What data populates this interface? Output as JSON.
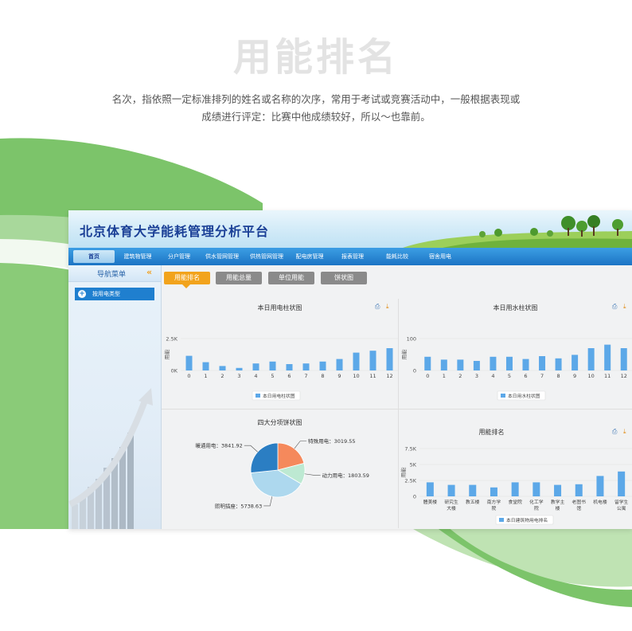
{
  "header": {
    "title": "用能排名",
    "desc_line1": "名次，指依照一定标准排列的姓名或名称的次序，常用于考试或竞赛活动中，一般根据表现或",
    "desc_line2": "成绩进行评定：比赛中他成绩较好，所以～也靠前。"
  },
  "app": {
    "banner_title": "北京体育大学能耗管理分析平台",
    "nav": [
      {
        "label": "首页",
        "active": true
      },
      {
        "label": "建筑物管理"
      },
      {
        "label": "分户管理"
      },
      {
        "label": "供水管网管理"
      },
      {
        "label": "供热管网管理"
      },
      {
        "label": "配电房管理"
      },
      {
        "label": "报表管理"
      },
      {
        "label": "能耗比较"
      },
      {
        "label": "宿舍用电"
      }
    ],
    "sidebar": {
      "title": "导航菜单",
      "collapse_icon": "double-chevron-left-icon",
      "items": [
        {
          "label": "按用电类型",
          "icon": "plus-circle-icon"
        }
      ]
    },
    "tabs": [
      {
        "label": "用能排名",
        "active": true
      },
      {
        "label": "用能总量"
      },
      {
        "label": "单位用能"
      },
      {
        "label": "饼状图"
      }
    ],
    "icons": {
      "print": "printer-icon",
      "download": "download-icon"
    }
  },
  "colors": {
    "nav_blue": "#1c74c4",
    "tab_active": "#f2a31c",
    "tab_inactive": "#8a8a8a",
    "bar": "#5ca8e8",
    "green_swoosh": "#7cc46a"
  },
  "chart_data": [
    {
      "type": "bar",
      "title": "本日用电柱状图",
      "ylabel": "用能",
      "y_ticks": [
        "0K",
        "2.5K"
      ],
      "ylim": [
        0,
        2500
      ],
      "categories": [
        "0",
        "1",
        "2",
        "3",
        "4",
        "5",
        "6",
        "7",
        "8",
        "9",
        "10",
        "11",
        "12"
      ],
      "series": [
        {
          "name": "本日用电柱状图",
          "values": [
            1150,
            650,
            350,
            200,
            550,
            700,
            500,
            550,
            700,
            900,
            1400,
            1550,
            1750
          ]
        }
      ]
    },
    {
      "type": "bar",
      "title": "本日用水柱状图",
      "ylabel": "用能",
      "y_ticks": [
        "0",
        "100"
      ],
      "ylim": [
        0,
        100
      ],
      "categories": [
        "0",
        "1",
        "2",
        "3",
        "4",
        "5",
        "6",
        "7",
        "8",
        "9",
        "10",
        "11",
        "12"
      ],
      "series": [
        {
          "name": "本日用水柱状图",
          "values": [
            43,
            34,
            34,
            30,
            43,
            43,
            36,
            45,
            38,
            49,
            70,
            81,
            70
          ]
        }
      ]
    },
    {
      "type": "pie",
      "title": "四大分项饼状图",
      "slices": [
        {
          "label": "特殊用电",
          "value": 3019.55,
          "color": "#f5895c"
        },
        {
          "label": "动力用电",
          "value": 1803.59,
          "color": "#bde9d2"
        },
        {
          "label": "照明插座",
          "value": 5738.63,
          "color": "#add8ee"
        },
        {
          "label": "暖通用电",
          "value": 3841.92,
          "color": "#2b7ec3"
        }
      ]
    },
    {
      "type": "bar",
      "title": "用能排名",
      "ylabel": "用能",
      "y_ticks": [
        "0",
        "2.5K",
        "5K",
        "7.5K"
      ],
      "ylim": [
        0,
        7500
      ],
      "categories": [
        "體美楼",
        "研究生大楼",
        "教五楼",
        "南方学院",
        "食堂院",
        "化工学院",
        "教学主楼",
        "老图书馆",
        "机电楼",
        "留学生公寓"
      ],
      "series": [
        {
          "name": "本日建筑物用电排名",
          "values": [
            2200,
            1800,
            1800,
            1400,
            2200,
            2200,
            1800,
            1900,
            3200,
            3900
          ]
        }
      ]
    }
  ]
}
